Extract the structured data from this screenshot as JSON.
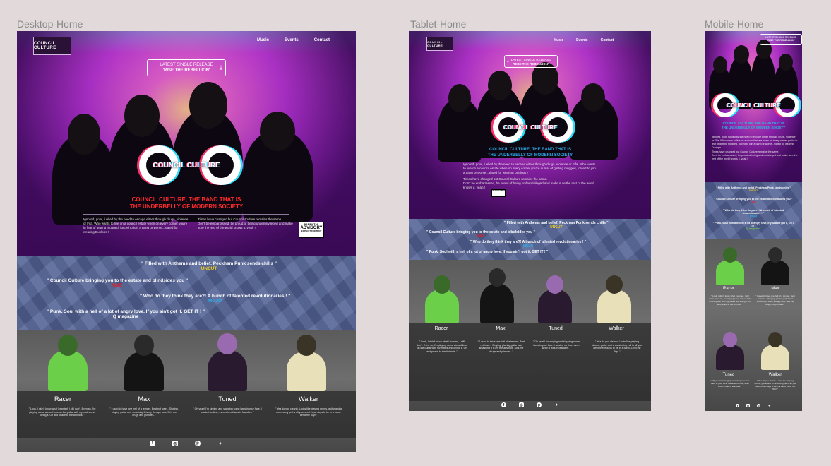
{
  "labels": {
    "desktop": "Desktop-Home",
    "tablet": "Tablet-Home",
    "mobile": "Mobile-Home"
  },
  "logo_text": "COUNCIL CULTURE",
  "nav": {
    "music": "Music",
    "events": "Events",
    "contact": "Contact"
  },
  "release": {
    "line1": "LATEST SINGLE RELEASE",
    "line2": "'RISE THE REBELLION'",
    "icon": "download-icon"
  },
  "band_name": "COUNCIL CULTURE",
  "tagline": {
    "line1": "COUNCIL CULTURE, THE BAND THAT IS",
    "line2": "THE UNDERBELLY OF MODERN SOCIETY"
  },
  "bio": {
    "p1": "Ignored, poor, fuelled by the need to escape either through drugs, violence or Fifa. Who wants to live on a council estate when on every corner you're in fear of getting mugged, forced to join a gang or worse...slated for wearing Dunlops !",
    "p2": "Times have changed but Council Culture remains the same.",
    "p3": "Don't be embarrassed, be proud of being underprivileged and make sure the rest of the world knows it, yeah !"
  },
  "advisory": {
    "l1": "PARENTAL",
    "l2": "ADVISORY",
    "l3": "EXPLICIT CONTENT"
  },
  "quotes": [
    {
      "text": "\" Filled with Anthems and belief, Peckham Punk sends chills \"",
      "source": "UNCUT",
      "color": "#f0d020"
    },
    {
      "text": "\" Council Culture bringing you to the estate and blindsides you \"",
      "source": "NME",
      "color": "#e0202a"
    },
    {
      "text": "\" Who do they think they are?! A bunch of talented revolutionaries ! \"",
      "source": "MOJO",
      "color": "#2ab0e8"
    },
    {
      "text": "\" Punk, Soul with a hell of a lot of angry love, If you ain't got it, GET IT ! \"",
      "source": "Q magazine",
      "color": "#6ad04a"
    }
  ],
  "members": [
    {
      "name": "Racer",
      "quote": "\" Look, I didn't know what I wanted, I still don't. Even so, I'm playing some wicked licks on the guitar with my mates and loving it. Oh and peace to the Animals. \""
    },
    {
      "name": "Max",
      "quote": "\" I used to have one hell of a temper. Best not lose... Singing, playing guitar and smashing it is my therapy now. So's me drugs and pilmoles. \""
    },
    {
      "name": "Tuned",
      "quote": "\" Oh yeah! I'm singing and slapping some bass in your face. I wasted no time, even when it was in Mandies. \""
    },
    {
      "name": "Walker",
      "quote": "\" Yea do you clearin. Looks like playing drums, guitar and a convincing yell is all you need these days to be in a band. Lend me 50p! \""
    }
  ],
  "social": [
    "facebook-icon",
    "instagram-icon",
    "pinterest-icon",
    "twitter-icon"
  ],
  "colors": {
    "tagline_desktop": "#ff2a2a",
    "tagline_tablet": "#2aa8e8",
    "tagline_mobile": "#2ab6e0",
    "racer_green": "#6ccf4a",
    "walker_cream": "#e8e0b8",
    "tuned_purple": "#9a6ab0"
  }
}
